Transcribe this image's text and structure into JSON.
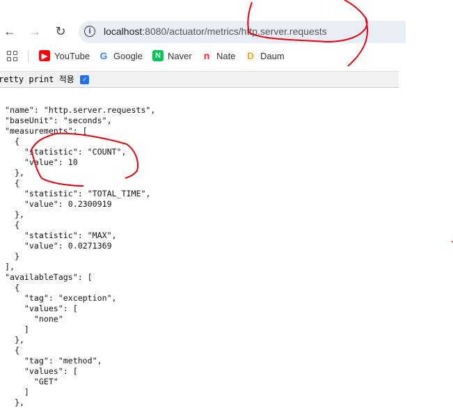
{
  "browser": {
    "url_host": "localhost",
    "url_rest": ":8080/actuator/metrics/http.server.requests",
    "back_icon": "arrow-left",
    "forward_icon": "arrow-right",
    "reload_icon": "reload",
    "site_info_icon": "info-circle"
  },
  "bookmarks": [
    {
      "label": "YouTube",
      "icon": "youtube-icon",
      "glyph": "▶",
      "color": "#ff0000"
    },
    {
      "label": "Google",
      "icon": "google-icon",
      "glyph": "G",
      "color": "#4285f4"
    },
    {
      "label": "Naver",
      "icon": "naver-icon",
      "glyph": "N",
      "color": "#03c75a"
    },
    {
      "label": "Nate",
      "icon": "nate-icon",
      "glyph": "n",
      "color": "#ff1a2c"
    },
    {
      "label": "Daum",
      "icon": "daum-icon",
      "glyph": "D",
      "color": "#f5a623"
    }
  ],
  "pretty_print": {
    "label": "retty print 적용",
    "checked": true
  },
  "json_lines": [
    "\"name\": \"http.server.requests\",",
    "\"baseUnit\": \"seconds\",",
    "\"measurements\": [",
    "  {",
    "    \"statistic\": \"COUNT\",",
    "    \"value\": 10",
    "  },",
    "  {",
    "    \"statistic\": \"TOTAL_TIME\",",
    "    \"value\": 0.2300919",
    "  },",
    "  {",
    "    \"statistic\": \"MAX\",",
    "    \"value\": 0.0271369",
    "  }",
    "],",
    "\"availableTags\": [",
    "  {",
    "    \"tag\": \"exception\",",
    "    \"values\": [",
    "      \"none\"",
    "    ]",
    "  },",
    "  {",
    "    \"tag\": \"method\",",
    "    \"values\": [",
    "      \"GET\"",
    "    ]",
    "  },"
  ],
  "annotation_color": "#e8000b"
}
